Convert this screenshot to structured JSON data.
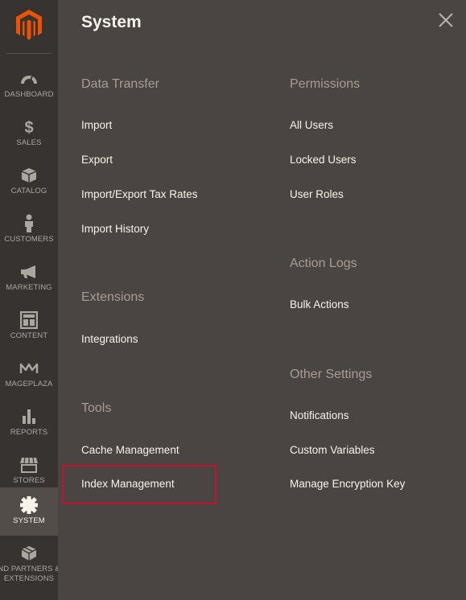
{
  "sidebar": {
    "logo": {
      "icon": "magento-logo-icon",
      "color": "#eb5202"
    },
    "items": [
      {
        "id": "dashboard",
        "label": "DASHBOARD",
        "icon": "speedometer-icon"
      },
      {
        "id": "sales",
        "label": "SALES",
        "icon": "dollar-icon"
      },
      {
        "id": "catalog",
        "label": "CATALOG",
        "icon": "box-icon"
      },
      {
        "id": "customers",
        "label": "CUSTOMERS",
        "icon": "person-icon"
      },
      {
        "id": "marketing",
        "label": "MARKETING",
        "icon": "megaphone-icon"
      },
      {
        "id": "content",
        "label": "CONTENT",
        "icon": "layout-icon"
      },
      {
        "id": "mageplaza",
        "label": "MAGEPLAZA",
        "icon": "mageplaza-icon"
      },
      {
        "id": "reports",
        "label": "REPORTS",
        "icon": "bar-chart-icon"
      },
      {
        "id": "stores",
        "label": "STORES",
        "icon": "store-icon"
      },
      {
        "id": "system",
        "label": "SYSTEM",
        "icon": "gear-icon",
        "active": true
      },
      {
        "id": "partners",
        "label": "ND PARTNERS & EXTENSIONS",
        "icon": "blocks-icon"
      }
    ]
  },
  "panel": {
    "title": "System",
    "close_icon": "close-icon",
    "highlight_color": "#c8102e",
    "left_column": [
      {
        "title": "Data Transfer",
        "links": [
          "Import",
          "Export",
          "Import/Export Tax Rates",
          "Import History"
        ]
      },
      {
        "title": "Extensions",
        "links": [
          "Integrations"
        ]
      },
      {
        "title": "Tools",
        "links": [
          "Cache Management",
          "Index Management"
        ]
      }
    ],
    "right_column": [
      {
        "title": "Permissions",
        "links": [
          "All Users",
          "Locked Users",
          "User Roles"
        ]
      },
      {
        "title": "Action Logs",
        "links": [
          "Bulk Actions"
        ]
      },
      {
        "title": "Other Settings",
        "links": [
          "Notifications",
          "Custom Variables",
          "Manage Encryption Key"
        ]
      }
    ]
  }
}
